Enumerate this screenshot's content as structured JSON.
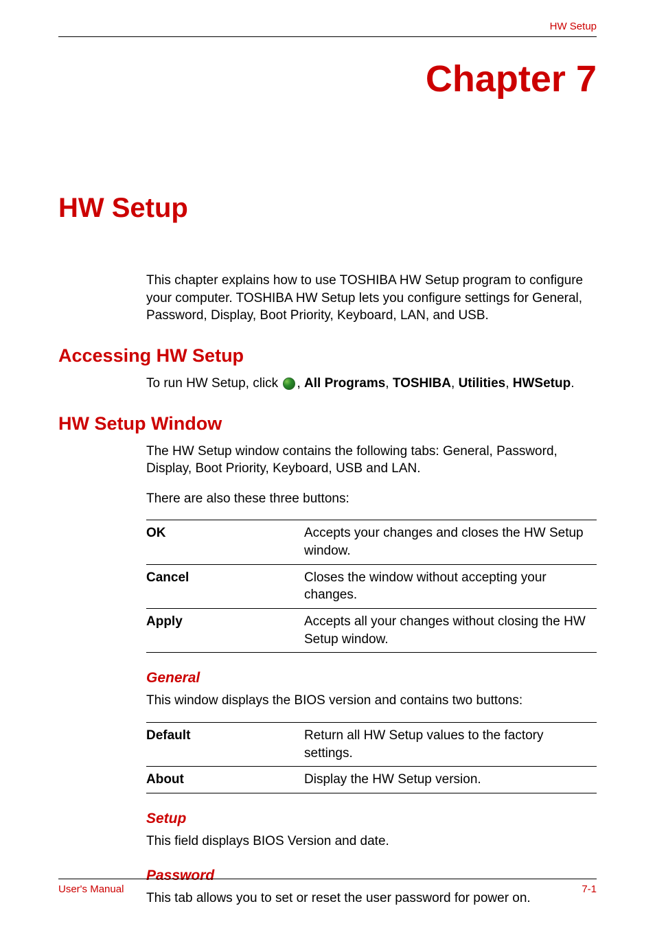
{
  "header": {
    "label": "HW Setup"
  },
  "chapter": {
    "title": "Chapter 7"
  },
  "page": {
    "title": "HW Setup"
  },
  "intro": "This chapter explains how to use TOSHIBA HW Setup program to configure your computer. TOSHIBA HW Setup lets you configure settings for General, Password, Display, Boot Priority, Keyboard, LAN, and USB.",
  "sections": {
    "accessing": {
      "heading": "Accessing HW Setup",
      "run_prefix": "To run HW Setup, click ",
      "run_parts": {
        "comma": ", ",
        "all_programs": "All Programs",
        "toshiba": "TOSHIBA",
        "utilities": "Utilities",
        "hwsetup": "HWSetup",
        "period": "."
      }
    },
    "window": {
      "heading": "HW Setup Window",
      "para1": "The HW Setup window contains the following tabs: General, Password, Display, Boot Priority, Keyboard, USB and LAN.",
      "para2": "There are also these three buttons:",
      "buttons": [
        {
          "term": "OK",
          "desc": "Accepts your changes and closes the HW Setup window."
        },
        {
          "term": "Cancel",
          "desc": "Closes the window without accepting your changes."
        },
        {
          "term": "Apply",
          "desc": "Accepts all your changes without closing the HW Setup window."
        }
      ]
    },
    "general": {
      "heading": "General",
      "para": "This window displays the BIOS version and contains two buttons:",
      "items": [
        {
          "term": "Default",
          "desc": "Return all HW Setup values to the factory settings."
        },
        {
          "term": "About",
          "desc": "Display the HW Setup version."
        }
      ]
    },
    "setup": {
      "heading": "Setup",
      "para": "This field displays BIOS Version and date."
    },
    "password": {
      "heading": "Password",
      "para": "This tab allows you to set or reset the user password for power on."
    }
  },
  "footer": {
    "left": "User's Manual",
    "right": "7-1"
  }
}
